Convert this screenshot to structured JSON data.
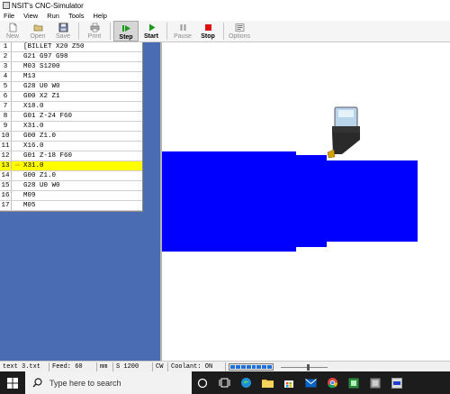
{
  "window": {
    "title": "NSIT's CNC-Simulator"
  },
  "menu": [
    "File",
    "View",
    "Run",
    "Tools",
    "Help"
  ],
  "toolbar": {
    "new": "New",
    "open": "Open",
    "save": "Save",
    "print": "Print",
    "step": "Step",
    "start": "Start",
    "pause": "Pause",
    "stop": "Stop",
    "options": "Options"
  },
  "program": {
    "current_line": 13,
    "lines": [
      {
        "n": "1",
        "code": "[BILLET X20 Z50"
      },
      {
        "n": "2",
        "code": "G21 G97 G98"
      },
      {
        "n": "3",
        "code": "M03 S1200"
      },
      {
        "n": "4",
        "code": "M13"
      },
      {
        "n": "5",
        "code": "G28 U0 W0"
      },
      {
        "n": "6",
        "code": "G00 X2 Z1"
      },
      {
        "n": "7",
        "code": "X18.0"
      },
      {
        "n": "8",
        "code": "G01 Z-24 F60"
      },
      {
        "n": "9",
        "code": "X31.0"
      },
      {
        "n": "10",
        "code": "G00 Z1.0"
      },
      {
        "n": "11",
        "code": "X16.0"
      },
      {
        "n": "12",
        "code": "G01 Z-18 F60"
      },
      {
        "n": "13",
        "code": "X31.0"
      },
      {
        "n": "14",
        "code": "G00 Z1.0"
      },
      {
        "n": "15",
        "code": "G28 U0 W0"
      },
      {
        "n": "16",
        "code": "M09"
      },
      {
        "n": "17",
        "code": "M05"
      }
    ]
  },
  "status": {
    "file": "text 3.txt",
    "feed": "Feed: 60",
    "unit": "mm",
    "spindle": "S 1200",
    "direction": "CW",
    "coolant": "Coolant: ON",
    "progress_segments_filled": 8,
    "progress_segments_total": 8,
    "speed_slider_fraction": 0.6
  },
  "taskbar": {
    "search_placeholder": "Type here to search"
  },
  "colors": {
    "workpiece": "#0000ff",
    "highlight": "#ffff00",
    "left_panel": "#4a6cb2",
    "tool_insert": "#d4a000"
  }
}
